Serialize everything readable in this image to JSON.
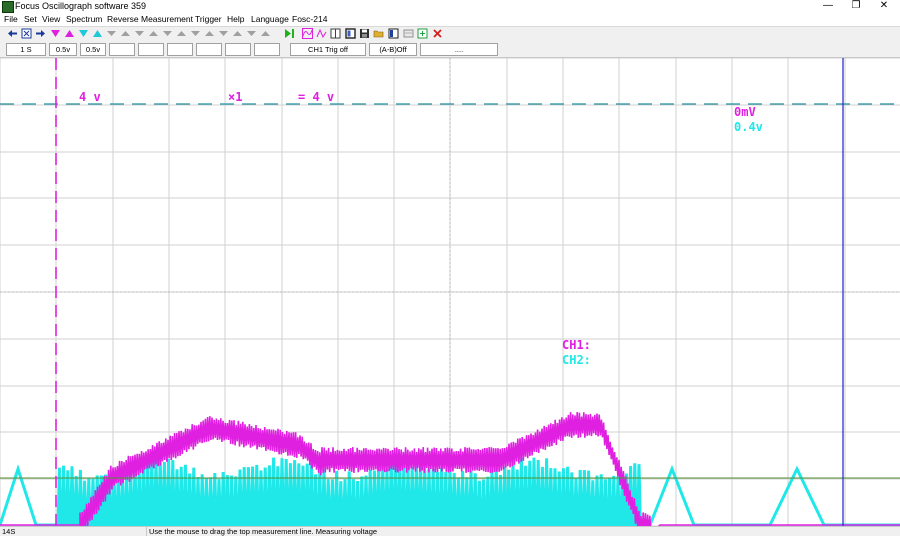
{
  "window": {
    "title": "Focus Oscillograph software 359",
    "minimize": "—",
    "maximize": "❐",
    "close": "✕"
  },
  "menu": [
    "File",
    "Set",
    "View",
    "Spectrum",
    "Reverse",
    "Measurement",
    "Trigger",
    "Help",
    "Language",
    "Fosc-214"
  ],
  "toolbar": {
    "icons": [
      "arrow-left-icon",
      "zoom-box-icon",
      "arrow-right-icon",
      "ch1-trigger-down-icon",
      "ch1-trigger-up-icon",
      "ch2-trigger-down-icon",
      "ch2-trigger-up-icon",
      "trigger-fall-1-icon",
      "trigger-fall-2-icon",
      "trigger-fall-3-icon",
      "trigger-fall-4-icon",
      "trigger-fall-5-icon",
      "trigger-fall-6-icon",
      "trigger-fall-7-icon",
      "trigger-fall-8-icon",
      "trigger-fall-9-icon",
      "trigger-fall-10-icon",
      "trigger-fall-11-icon",
      "trigger-fall-12-icon",
      "run-icon",
      "single-icon",
      "measure-icon",
      "cursor-icon",
      "grid-icon",
      "save-icon",
      "open-folder-icon",
      "copy-icon",
      "print-icon",
      "settings-icon",
      "exit-icon"
    ]
  },
  "status": {
    "timebase": "1 S",
    "ch1_volts": "0.5v",
    "ch2_volts": "0.5v",
    "trigger": "CH1 Trig off",
    "math": "(A-B)Off",
    "extra": "...."
  },
  "scope": {
    "ch1_color": "#e020e0",
    "ch2_color": "#20e8e8",
    "cursor_color": "#3030d0",
    "trigger_line_color": "#509030",
    "ref_line_color": "#2090a0",
    "scale_volts": "4 v",
    "scale_multiplier": "×1",
    "scale_result": "= 4 v",
    "offset_ch1": "0mV",
    "offset_ch2": "0.4v",
    "measure_ch1": "CH1:",
    "measure_ch2": "CH2:"
  },
  "bottom": {
    "time": "14S",
    "hint": "Use the mouse to drag the top measurement line. Measuring voltage"
  }
}
